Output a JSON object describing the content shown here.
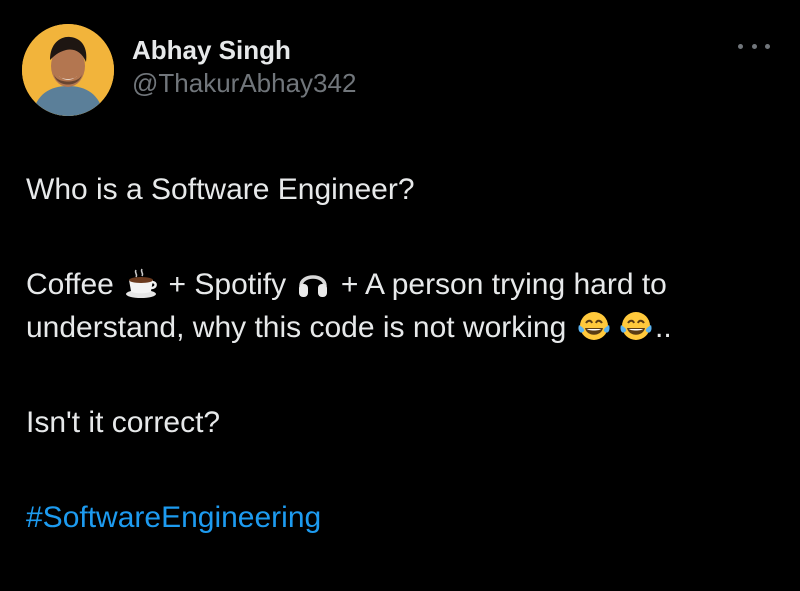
{
  "author": {
    "display_name": "Abhay Singh",
    "handle": "@ThakurAbhay342"
  },
  "tweet": {
    "line1": "Who is a Software Engineer?",
    "line2_a": "Coffee",
    "line2_b": "+ Spotify",
    "line2_c": "+ A person trying hard to",
    "line3_a": "understand, why this code is not working",
    "line3_b": "..",
    "line4": "Isn't it correct?",
    "hashtag": "#SoftwareEngineering"
  },
  "icons": {
    "more": "more-options-icon",
    "coffee": "coffee-emoji",
    "headphones": "headphones-emoji",
    "laugh": "tears-of-joy-emoji"
  },
  "colors": {
    "background": "#000000",
    "text": "#e7e9ea",
    "secondary": "#71767b",
    "accent": "#1d9bf0"
  }
}
